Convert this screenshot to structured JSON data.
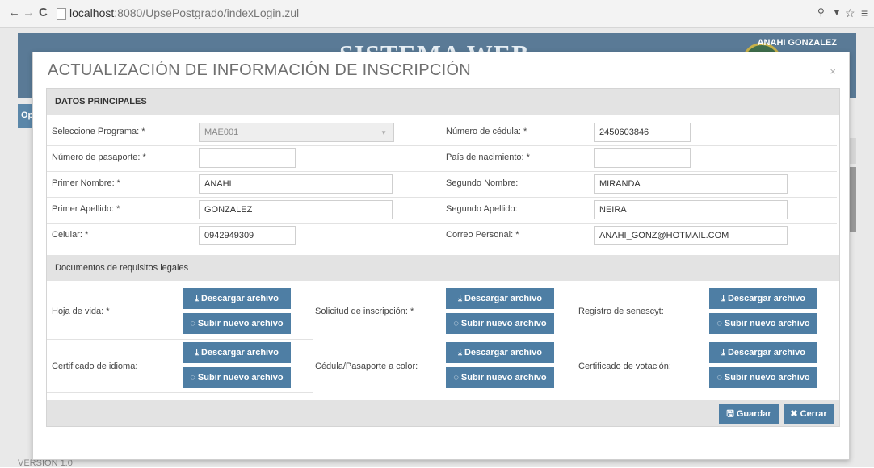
{
  "browser": {
    "url_host": "localhost",
    "url_rest": ":8080/UpsePostgrado/indexLogin.zul",
    "back_icon": "←",
    "forward_icon": "→",
    "reload_icon": "C",
    "zoom_icon": "🔍",
    "ext_icon": "🔔",
    "star_icon": "☆",
    "menu_icon": "≡"
  },
  "app": {
    "title": "SISTEMA WEB",
    "user": "ANAHI GONZALEZ",
    "side_tab": "Op",
    "version": "VERSION 1.0"
  },
  "modal": {
    "title": "ACTUALIZACIÓN DE INFORMACIÓN DE INSCRIPCIÓN",
    "close": "×",
    "section_main": "DATOS PRINCIPALES",
    "fields": {
      "programa": {
        "label": "Seleccione Programa: *",
        "value": "MAE001"
      },
      "cedula": {
        "label": "Número de cédula: *",
        "value": "2450603846"
      },
      "pasaporte": {
        "label": "Número de pasaporte: *",
        "value": ""
      },
      "pais": {
        "label": "País de nacimiento: *",
        "value": ""
      },
      "primer_nombre": {
        "label": "Primer Nombre: *",
        "value": "ANAHI"
      },
      "segundo_nombre": {
        "label": "Segundo Nombre:",
        "value": "MIRANDA"
      },
      "primer_apellido": {
        "label": "Primer Apellido: *",
        "value": "GONZALEZ"
      },
      "segundo_apellido": {
        "label": "Segundo Apellido:",
        "value": "NEIRA"
      },
      "celular": {
        "label": "Celular: *",
        "value": "0942949309"
      },
      "correo": {
        "label": "Correo Personal: *",
        "value": "ANAHI_GONZ@HOTMAIL.COM"
      }
    },
    "section_docs": "Documentos de requisitos legales",
    "docs": {
      "hoja_vida": "Hoja de vida: *",
      "solicitud": "Solicitud de inscripción: *",
      "senescyt": "Registro de senescyt:",
      "idioma": "Certificado de idioma:",
      "cedula_color": "Cédula/Pasaporte a color:",
      "votacion": "Certificado de votación:"
    },
    "btn_download": "Descargar archivo",
    "btn_upload": "Subir nuevo archivo",
    "btn_save": "Guardar",
    "btn_close": "Cerrar"
  },
  "colors": {
    "button": "#4e7ea4",
    "header_bg": "#5a7a96",
    "section_bg": "#e3e3e3"
  }
}
